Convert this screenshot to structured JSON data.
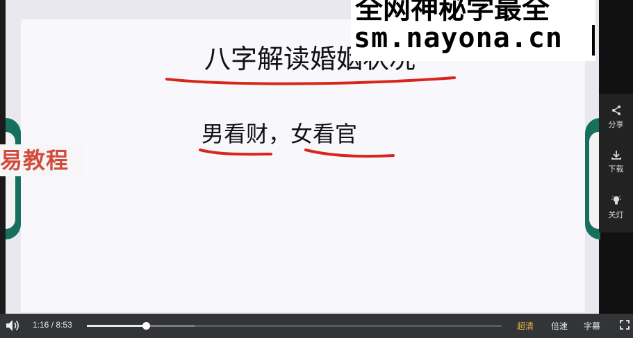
{
  "slide": {
    "title": "八字解读婚姻状况",
    "subtitle": "男看财，女看官",
    "side_tag": "易教程"
  },
  "watermark": {
    "line1": "全网神秘学最全",
    "line2": "sm.nayona.cn"
  },
  "side_panel": {
    "share_label": "分享",
    "download_label": "下载",
    "light_label": "关灯"
  },
  "controls": {
    "current_time": "1:16",
    "separator": "/",
    "duration": "8:53",
    "progress_fraction": 0.143,
    "buffered_fraction": 0.26,
    "quality_label": "超清",
    "speed_label": "倍速",
    "subtitle_label": "字幕"
  },
  "colors": {
    "ink_red": "#d8261d",
    "teal": "#17705e",
    "quality_active": "#f1b24a"
  },
  "icons": {
    "volume": "volume-icon",
    "share": "share-icon",
    "download": "download-icon",
    "light": "lightbulb-icon",
    "fullscreen": "fullscreen-icon"
  }
}
